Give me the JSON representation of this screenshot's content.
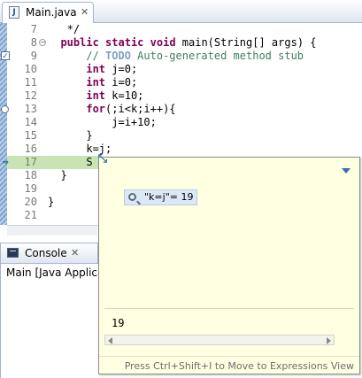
{
  "editor": {
    "tab_label": "Main.java",
    "tab_icon": "java-file-icon",
    "tab_close_glyph": "✕",
    "lines": [
      {
        "num": "7",
        "text": "   */"
      },
      {
        "num": "8",
        "text": "  public static void main(String[] args) {",
        "fold": true
      },
      {
        "num": "9",
        "text": "      // TODO Auto-generated method stub"
      },
      {
        "num": "10",
        "text": "      int j=0;"
      },
      {
        "num": "11",
        "text": "      int i=0;"
      },
      {
        "num": "12",
        "text": "      int k=10;"
      },
      {
        "num": "13",
        "text": "      for(;i<k;i++){"
      },
      {
        "num": "14",
        "text": "          j=i+10;"
      },
      {
        "num": "15",
        "text": "      }"
      },
      {
        "num": "16",
        "text": "      k=j;"
      },
      {
        "num": "17",
        "text": "      S",
        "current": true
      },
      {
        "num": "18",
        "text": "  }"
      },
      {
        "num": "19",
        "text": ""
      },
      {
        "num": "20",
        "text": "}"
      },
      {
        "num": "21",
        "text": ""
      }
    ]
  },
  "console": {
    "tab_label": "Console",
    "tab_icon": "console-icon",
    "tab_close_glyph": "✕",
    "description": "Main [Java Applicat"
  },
  "inspect_popup": {
    "expression": "\"k=j\"= 19",
    "expression_icon": "magnifier-icon",
    "detail_value": "19",
    "hint": "Press Ctrl+Shift+I to Move to Expressions View",
    "menu_icon": "view-menu-icon"
  },
  "colors": {
    "keyword": "#7f0055",
    "comment": "#3f7f5f",
    "todo": "#7f9fbf",
    "current_line": "#c8e4b4",
    "popup_background": "#ffffe1"
  }
}
